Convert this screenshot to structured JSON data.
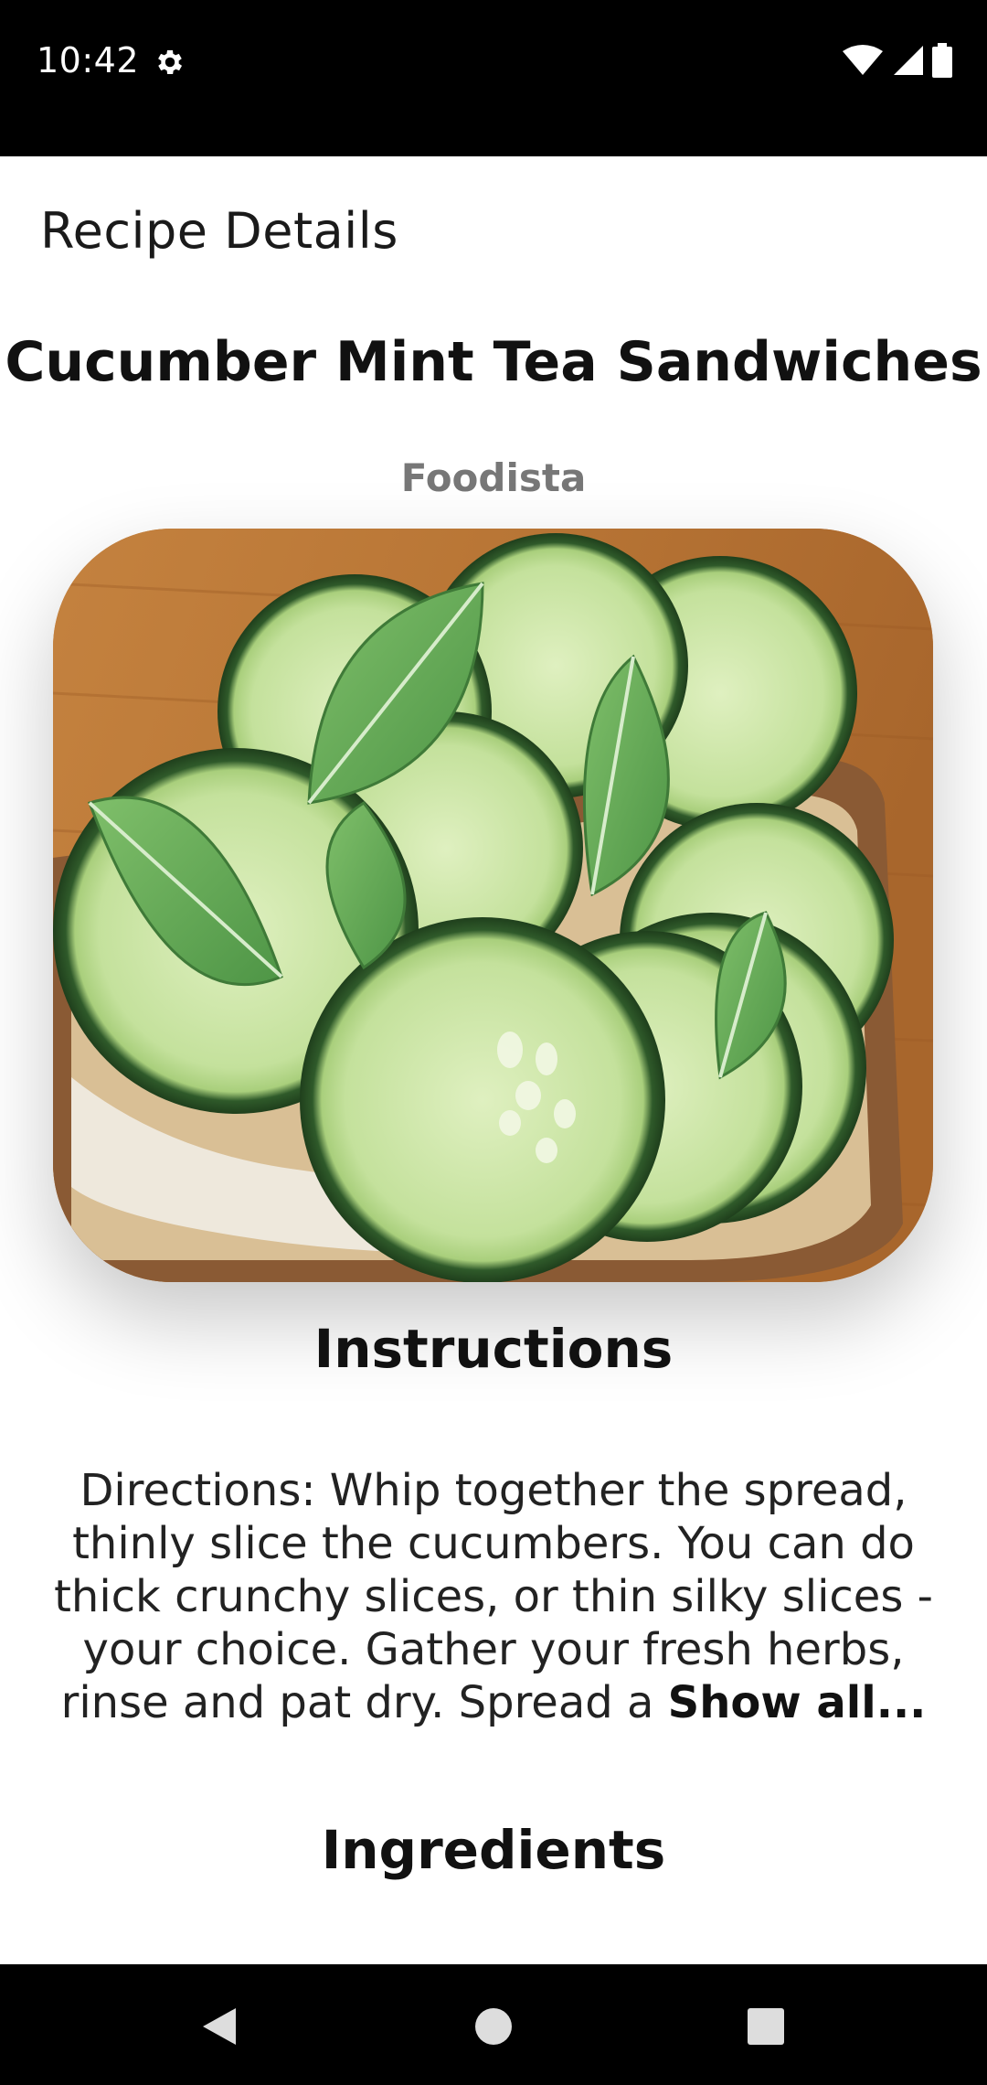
{
  "status_bar": {
    "time": "10:42",
    "icons": [
      "gear-icon",
      "wifi-icon",
      "signal-icon",
      "battery-icon"
    ]
  },
  "app": {
    "title": "Recipe Details"
  },
  "recipe": {
    "name": "Cucumber Mint Tea Sandwiches",
    "source": "Foodista",
    "image": "cucumber-mint-sandwich-photo",
    "instructions_title": "Instructions",
    "instructions_text": "Directions: Whip together the spread, thinly slice the cucumbers. You can do thick crunchy slices, or thin silky slices - your choice. Gather your fresh herbs, rinse and pat dry. Spread a",
    "show_all_label": "Show all...",
    "ingredients_title": "Ingredients"
  },
  "nav_bar": {
    "buttons": [
      "back-icon",
      "home-icon",
      "recents-icon"
    ]
  },
  "colors": {
    "status_bar_bg": "#000000",
    "content_bg": "#ffffff",
    "source_text": "#777777"
  }
}
